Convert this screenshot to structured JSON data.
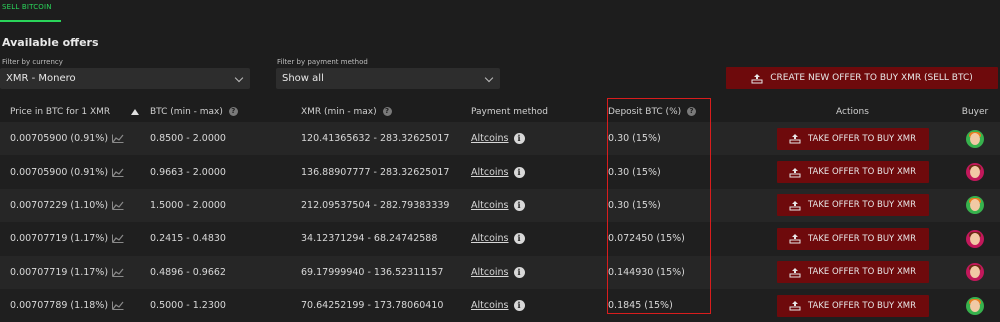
{
  "tab": {
    "label": "SELL BITCOIN"
  },
  "section_title": "Available offers",
  "filters": {
    "currency": {
      "label": "Filter by currency",
      "value": "XMR  -  Monero"
    },
    "payment": {
      "label": "Filter by payment method",
      "value": "Show all"
    }
  },
  "create_button": {
    "label": "CREATE NEW OFFER TO BUY XMR (SELL BTC)"
  },
  "columns": {
    "price": "Price in BTC for 1 XMR",
    "btc": "BTC (min - max)",
    "xmr": "XMR (min - max)",
    "payment": "Payment method",
    "deposit": "Deposit BTC (%)",
    "actions": "Actions",
    "buyer": "Buyer"
  },
  "offers": [
    {
      "price": "0.00705900 (0.91%)",
      "btc": "0.8500 - 2.0000",
      "xmr": "120.41365632 - 283.32625017",
      "payment": "Altcoins",
      "deposit": "0.30 (15%)",
      "action": "TAKE OFFER TO BUY XMR"
    },
    {
      "price": "0.00705900 (0.91%)",
      "btc": "0.9663 - 2.0000",
      "xmr": "136.88907777 - 283.32625017",
      "payment": "Altcoins",
      "deposit": "0.30 (15%)",
      "action": "TAKE OFFER TO BUY XMR"
    },
    {
      "price": "0.00707229 (1.10%)",
      "btc": "1.5000 - 2.0000",
      "xmr": "212.09537504 - 282.79383339",
      "payment": "Altcoins",
      "deposit": "0.30 (15%)",
      "action": "TAKE OFFER TO BUY XMR"
    },
    {
      "price": "0.00707719 (1.17%)",
      "btc": "0.2415 - 0.4830",
      "xmr": "34.12371294 - 68.24742588",
      "payment": "Altcoins",
      "deposit": "0.072450 (15%)",
      "action": "TAKE OFFER TO BUY XMR"
    },
    {
      "price": "0.00707719 (1.17%)",
      "btc": "0.4896 - 0.9662",
      "xmr": "69.17999940 - 136.52311157",
      "payment": "Altcoins",
      "deposit": "0.144930 (15%)",
      "action": "TAKE OFFER TO BUY XMR"
    },
    {
      "price": "0.00707789 (1.18%)",
      "btc": "0.5000 - 1.2300",
      "xmr": "70.64252199 - 173.78060410",
      "payment": "Altcoins",
      "deposit": "0.1845 (15%)",
      "action": "TAKE OFFER TO BUY XMR"
    }
  ],
  "colors": {
    "accent": "#2ad45a",
    "button": "#6e0a0c",
    "highlight": "#d81d1d"
  },
  "icons": [
    "chart-icon",
    "help-icon",
    "info-icon",
    "sort-up-icon",
    "chevron-down-icon",
    "offer-icon",
    "avatar-icon"
  ]
}
